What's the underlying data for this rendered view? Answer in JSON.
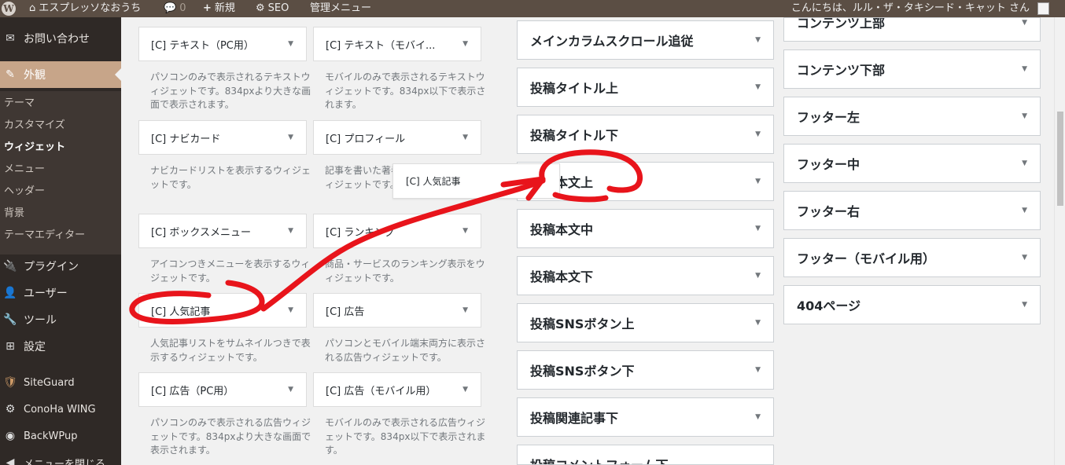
{
  "adminbar": {
    "site_name": "エスプレッソなおうち",
    "comments_count": "0",
    "new_label": "新規",
    "seo_label": "SEO",
    "manage_label": "管理メニュー",
    "greeting": "こんにちは、ルル・ザ・タキシード・キャット さん"
  },
  "sidebar": {
    "contact": "お問い合わせ",
    "appearance": "外観",
    "sub": [
      "テーマ",
      "カスタマイズ",
      "ウィジェット",
      "メニュー",
      "ヘッダー",
      "背景",
      "テーマエディター"
    ],
    "plugins": "プラグイン",
    "users": "ユーザー",
    "tools": "ツール",
    "settings": "設定",
    "siteguard": "SiteGuard",
    "conoha": "ConoHa WING",
    "backwpup": "BackWPup",
    "collapse": "メニューを閉じる"
  },
  "widgets": {
    "text_pc": {
      "title": "[C] テキスト（PC用）",
      "desc": "パソコンのみで表示されるテキストウィジェットです。834pxより大きな画面で表示されます。"
    },
    "text_mobile": {
      "title": "[C] テキスト（モバイ...",
      "desc": "モバイルのみで表示されるテキストウィジェットです。834px以下で表示されます。"
    },
    "navicard": {
      "title": "[C] ナビカード",
      "desc": "ナビカードリストを表示するウィジェットです。"
    },
    "profile": {
      "title": "[C] プロフィール",
      "desc": "記事を書いた著者の情報を表示するウィジェットです。"
    },
    "boxmenu": {
      "title": "[C] ボックスメニュー",
      "desc": "アイコンつきメニューを表示するウィジェットです。"
    },
    "ranking": {
      "title": "[C] ランキング",
      "desc": "商品・サービスのランキング表示をウィジェットです。"
    },
    "popular": {
      "title": "[C] 人気記事",
      "desc": "人気記事リストをサムネイルつきで表示するウィジェットです。"
    },
    "ad": {
      "title": "[C] 広告",
      "desc": "パソコンとモバイル端末両方に表示される広告ウィジェットです。"
    },
    "ad_pc": {
      "title": "[C] 広告（PC用）",
      "desc": "パソコンのみで表示される広告ウィジェットです。834pxより大きな画面で表示されます。"
    },
    "ad_mobile": {
      "title": "[C] 広告（モバイル用）",
      "desc": "モバイルのみで表示される広告ウィジェットです。834px以下で表示されます。"
    }
  },
  "drag_helper": "[C] 人気記事",
  "areas_col1": [
    "メインカラムスクロール追従",
    "投稿タイトル上",
    "投稿タイトル下",
    "投稿本文上",
    "投稿本文中",
    "投稿本文下",
    "投稿SNSボタン上",
    "投稿SNSボタン下",
    "投稿関連記事下",
    "投稿コメントフォーム下"
  ],
  "areas_col2": [
    "コンテンツ上部",
    "コンテンツ下部",
    "フッター左",
    "フッター中",
    "フッター右",
    "フッター（モバイル用）",
    "404ページ"
  ],
  "annotation": {
    "color": "#e8141b"
  }
}
